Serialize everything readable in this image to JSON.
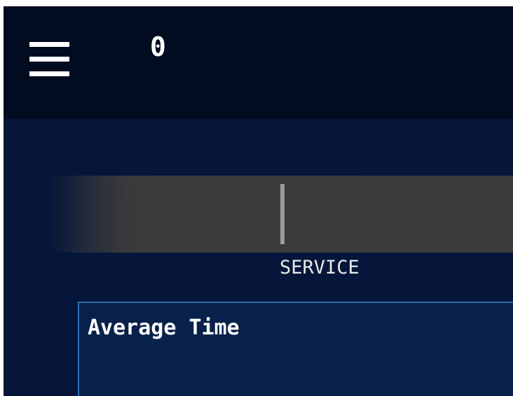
{
  "header": {
    "counter": "0"
  },
  "queue": {
    "service_label": "SERVICE"
  },
  "stats": {
    "title": "Average Time"
  },
  "colors": {
    "background": "#06163a",
    "topbar": "#010c20",
    "track": "#3b3b3b",
    "panel": "#08214a",
    "panel_border": "#2f6fb1",
    "text": "#ffffff"
  },
  "icons": {
    "menu": "hamburger-menu-icon"
  }
}
